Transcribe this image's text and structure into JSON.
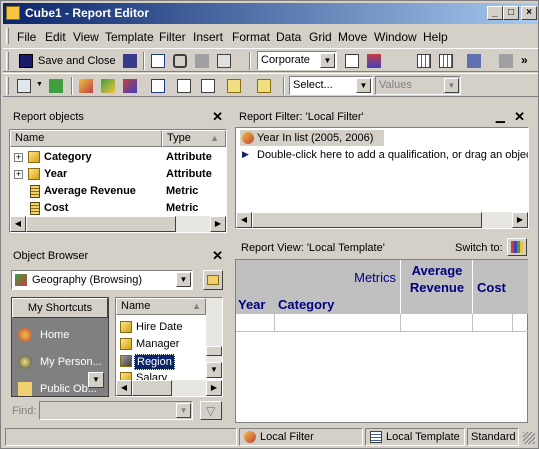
{
  "window": {
    "title": "Cube1 - Report Editor",
    "minimize": "_",
    "maximize": "□",
    "close": "×"
  },
  "menu": [
    "File",
    "Edit",
    "View",
    "Template",
    "Filter",
    "Insert",
    "Format",
    "Data",
    "Grid",
    "Move",
    "Window",
    "Help"
  ],
  "toolbar": {
    "save_close_label": "Save and Close",
    "style_value": "Corporate",
    "select_value": "Select...",
    "values_value": "Values"
  },
  "report_objects": {
    "title": "Report objects",
    "col_name": "Name",
    "col_type": "Type",
    "rows": [
      {
        "name": "Category",
        "type": "Attribute",
        "expand": "+"
      },
      {
        "name": "Year",
        "type": "Attribute",
        "expand": "+"
      },
      {
        "name": "Average Revenue",
        "type": "Metric",
        "expand": ""
      },
      {
        "name": "Cost",
        "type": "Metric",
        "expand": ""
      }
    ]
  },
  "report_filter": {
    "title": "Report Filter: 'Local Filter'",
    "item": "Year In list (2005, 2006)",
    "hint": "Double-click here to add a qualification, or drag an object"
  },
  "object_browser": {
    "title": "Object Browser",
    "location": "Geography (Browsing)",
    "shortcuts_title": "My Shortcuts",
    "shortcuts": [
      "Home",
      "My Person...",
      "Public Ob..."
    ],
    "col_name": "Name",
    "items": [
      "Hire Date",
      "Manager",
      "Region",
      "Salary"
    ],
    "find_label": "Find:"
  },
  "report_view": {
    "title": "Report View: 'Local Template'",
    "switch_to": "Switch to:",
    "metrics_label": "Metrics",
    "col_avg": "Average Revenue",
    "col_cost": "Cost",
    "row_year": "Year",
    "row_category": "Category"
  },
  "status": {
    "filter": "Local Filter",
    "template": "Local Template",
    "view": "Standard"
  }
}
